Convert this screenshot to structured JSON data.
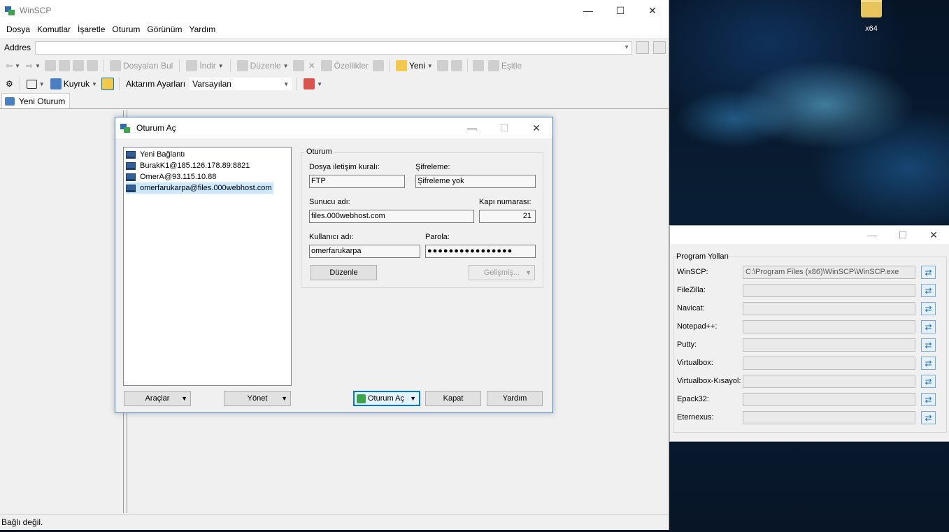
{
  "desktop": {
    "icon_label": "x64"
  },
  "main": {
    "title": "WinSCP",
    "menu": [
      "Dosya",
      "Komutlar",
      "İşaretle",
      "Oturum",
      "Görünüm",
      "Yardım"
    ],
    "address_label": "Addres",
    "toolbar": {
      "find_files": "Dosyaları Bul",
      "download": "İndir",
      "edit": "Düzenle",
      "properties": "Özellikler",
      "new": "Yeni",
      "sync": "Eşitle",
      "queue": "Kuyruk",
      "transfer_settings_label": "Aktarım Ayarları",
      "transfer_settings_value": "Varsayılan"
    },
    "tab_label": "Yeni Oturum",
    "status": "Bağlı değil."
  },
  "login": {
    "title": "Oturum Aç",
    "sites": [
      "Yeni Bağlantı",
      "BurakK1@185.126.178.89:8821",
      "OmerA@93.115.10.88",
      "omerfarukarpa@files.000webhost.com"
    ],
    "group_title": "Oturum",
    "protocol_label": "Dosya iletişim kuralı:",
    "protocol_value": "FTP",
    "encryption_label": "Şifreleme:",
    "encryption_value": "Şifreleme yok",
    "host_label": "Sunucu adı:",
    "host_value": "files.000webhost.com",
    "port_label": "Kapı numarası:",
    "port_value": "21",
    "user_label": "Kullanıcı adı:",
    "user_value": "omerfarukarpa",
    "password_label": "Parola:",
    "password_value": "●●●●●●●●●●●●●●●●",
    "edit_button": "Düzenle",
    "advanced_button": "Gelişmiş...",
    "tools_button": "Araçlar",
    "manage_button": "Yönet",
    "login_button": "Oturum Aç",
    "close_button": "Kapat",
    "help_button": "Yardım"
  },
  "paths": {
    "group_title": "Program Yolları",
    "rows": [
      {
        "label": "WinSCP:",
        "value": "C:\\Program Files (x86)\\WinSCP\\WinSCP.exe"
      },
      {
        "label": "FileZilla:",
        "value": ""
      },
      {
        "label": "Navicat:",
        "value": ""
      },
      {
        "label": "Notepad++:",
        "value": ""
      },
      {
        "label": "Putty:",
        "value": ""
      },
      {
        "label": "Virtualbox:",
        "value": ""
      },
      {
        "label": "Virtualbox-Kısayol:",
        "value": ""
      },
      {
        "label": "Epack32:",
        "value": ""
      },
      {
        "label": "Eternexus:",
        "value": ""
      }
    ]
  }
}
